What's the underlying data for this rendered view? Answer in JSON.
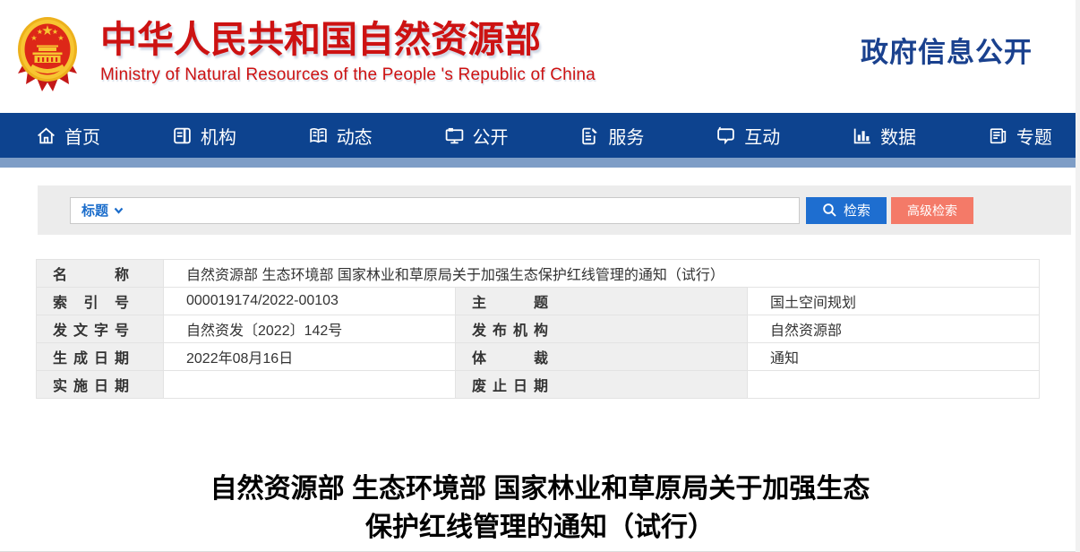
{
  "header": {
    "ministry_name_zh": "中华人民共和国自然资源部",
    "ministry_name_en": "Ministry of Natural Resources of the People 's Republic of China",
    "page_section": "政府信息公开"
  },
  "nav": {
    "items": [
      {
        "label": "首页",
        "icon": "home-icon"
      },
      {
        "label": "机构",
        "icon": "organization-icon"
      },
      {
        "label": "动态",
        "icon": "news-icon"
      },
      {
        "label": "公开",
        "icon": "disclosure-icon"
      },
      {
        "label": "服务",
        "icon": "services-icon"
      },
      {
        "label": "互动",
        "icon": "interaction-icon"
      },
      {
        "label": "数据",
        "icon": "data-icon"
      },
      {
        "label": "专题",
        "icon": "topics-icon"
      }
    ]
  },
  "search": {
    "filter_label": "标题",
    "input_value": "",
    "search_button": "检索",
    "advanced_search_button": "高级检索"
  },
  "doc_info": {
    "rows": [
      {
        "label": "名称",
        "value": "自然资源部 生态环境部 国家林业和草原局关于加强生态保护红线管理的通知（试行）"
      },
      {
        "label": "索引号",
        "value": "000019174/2022-00103",
        "label2": "主题",
        "value2": "国土空间规划"
      },
      {
        "label": "发文字号",
        "value": "自然资发〔2022〕142号",
        "label2": "发布机构",
        "value2": "自然资源部"
      },
      {
        "label": "生成日期",
        "value": "2022年08月16日",
        "label2": "体裁",
        "value2": "通知"
      },
      {
        "label": "实施日期",
        "value": "",
        "label2": "废止日期",
        "value2": ""
      }
    ]
  },
  "article": {
    "title_line1": "自然资源部 生态环境部 国家林业和草原局关于加强生态",
    "title_line2": "保护红线管理的通知（试行）"
  },
  "colors": {
    "brand_red": "#cd1212",
    "navy": "#1a418e",
    "navbar_blue": "#0d438f",
    "strip_blue": "#7e9dc6",
    "search_button_blue": "#1e6ed0",
    "advanced_button_coral": "#f47a68",
    "link_blue": "#1b6dcb"
  }
}
